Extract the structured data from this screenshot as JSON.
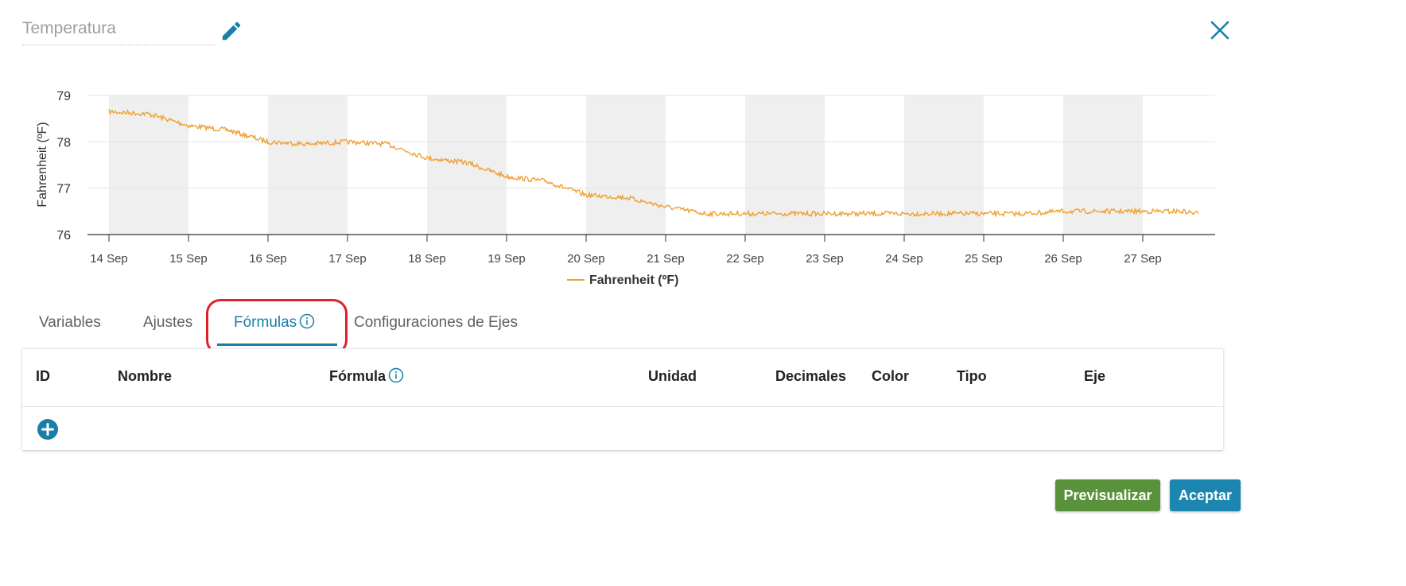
{
  "header": {
    "title_placeholder": "Temperatura",
    "edit_icon": "pencil-icon",
    "close_icon": "close-icon"
  },
  "colors": {
    "accent": "#1a7fa8",
    "series": "#f0a030",
    "highlight": "#e0202a",
    "preview_button": "#5a913b",
    "accept_button": "#1d86b0"
  },
  "chart_data": {
    "type": "line",
    "ylabel": "Fahrenheit (ºF)",
    "xlabel": "",
    "ylim": [
      76,
      79
    ],
    "yticks": [
      "76",
      "77",
      "78",
      "79"
    ],
    "xticks": [
      "14 Sep",
      "15 Sep",
      "16 Sep",
      "17 Sep",
      "18 Sep",
      "19 Sep",
      "20 Sep",
      "21 Sep",
      "22 Sep",
      "23 Sep",
      "24 Sep",
      "25 Sep",
      "26 Sep",
      "27 Sep"
    ],
    "x_unit": "days",
    "grid": true,
    "legend": "bottom-center",
    "series": [
      {
        "name": "Fahrenheit (ºF)",
        "x": [
          "14 Sep",
          "14 Sep 12:00",
          "15 Sep",
          "15 Sep 12:00",
          "16 Sep",
          "16 Sep 12:00",
          "17 Sep",
          "17 Sep 12:00",
          "18 Sep",
          "18 Sep 12:00",
          "19 Sep",
          "19 Sep 12:00",
          "20 Sep",
          "20 Sep 12:00",
          "21 Sep",
          "21 Sep 12:00",
          "22 Sep",
          "22 Sep 12:00",
          "23 Sep",
          "23 Sep 12:00",
          "24 Sep",
          "24 Sep 12:00",
          "25 Sep",
          "25 Sep 12:00",
          "26 Sep",
          "26 Sep 12:00",
          "27 Sep",
          "27 Sep 12:00",
          "27 Sep 16:48"
        ],
        "y": [
          78.65,
          78.6,
          78.35,
          78.25,
          78.0,
          77.95,
          78.0,
          77.95,
          77.65,
          77.55,
          77.25,
          77.15,
          76.85,
          76.8,
          76.6,
          76.45,
          76.45,
          76.45,
          76.45,
          76.45,
          76.45,
          76.45,
          76.45,
          76.45,
          76.5,
          76.5,
          76.5,
          76.5,
          76.45
        ]
      }
    ]
  },
  "tabs": [
    {
      "label": "Variables"
    },
    {
      "label": "Ajustes"
    },
    {
      "label": "Fórmulas",
      "active": true
    },
    {
      "label": "Configuraciones de Ejes"
    }
  ],
  "table": {
    "columns": [
      "ID",
      "Nombre",
      "Fórmula",
      "Unidad",
      "Decimales",
      "Color",
      "Tipo",
      "Eje"
    ],
    "rows": [],
    "add_icon": "plus-circle-icon"
  },
  "buttons": {
    "preview": "Previsualizar",
    "accept": "Aceptar"
  }
}
